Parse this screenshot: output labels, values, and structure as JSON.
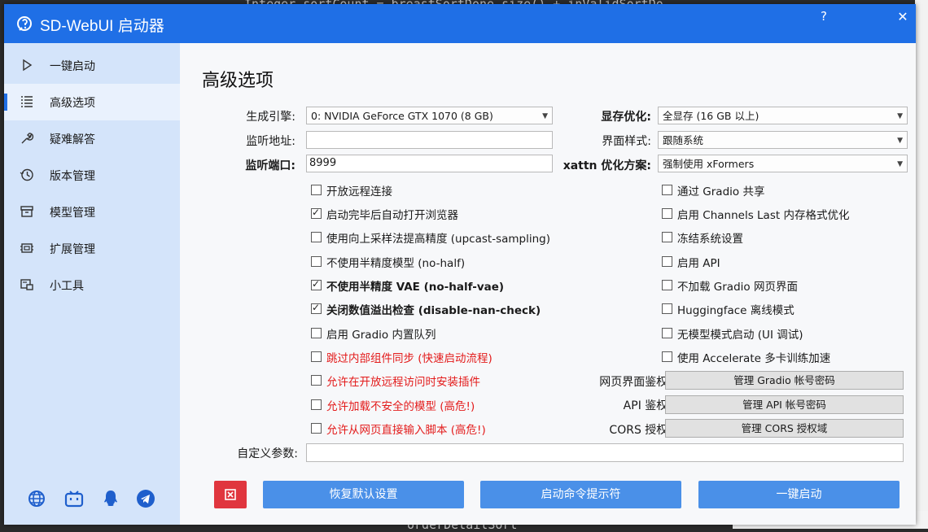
{
  "background": {
    "code_top": "Integer sortCount = breastSortDone.size() + inValidSortDo",
    "code_bottom": "orderDetailSort"
  },
  "window": {
    "title": "SD-WebUI 启动器",
    "help_glyph": "?",
    "close_glyph": "✕"
  },
  "sidebar": {
    "items": [
      {
        "label": "一键启动",
        "icon": "play-icon"
      },
      {
        "label": "高级选项",
        "icon": "list-icon",
        "active": true
      },
      {
        "label": "疑难解答",
        "icon": "wrench-icon"
      },
      {
        "label": "版本管理",
        "icon": "history-icon"
      },
      {
        "label": "模型管理",
        "icon": "archive-icon"
      },
      {
        "label": "扩展管理",
        "icon": "chip-icon"
      },
      {
        "label": "小工具",
        "icon": "tools-icon"
      }
    ],
    "footer_icons": [
      "globe-icon",
      "bilibili-icon",
      "qq-icon",
      "telegram-icon"
    ]
  },
  "page": {
    "title": "高级选项",
    "left": {
      "engine_label": "生成引擎:",
      "engine_value": "0: NVIDIA GeForce GTX 1070 (8 GB)",
      "listen_addr_label": "监听地址:",
      "listen_addr_value": "",
      "listen_port_label": "监听端口:",
      "listen_port_value": "8999",
      "checkboxes": [
        {
          "label": "开放远程连接",
          "checked": false
        },
        {
          "label": "启动完毕后自动打开浏览器",
          "checked": true
        },
        {
          "label": "使用向上采样法提高精度 (upcast-sampling)",
          "checked": false
        },
        {
          "label": "不使用半精度模型 (no-half)",
          "checked": false
        },
        {
          "label": "不使用半精度 VAE (no-half-vae)",
          "checked": true,
          "bold": true
        },
        {
          "label": "关闭数值溢出检查 (disable-nan-check)",
          "checked": true,
          "bold": true
        },
        {
          "label": "启用 Gradio 内置队列",
          "checked": false
        },
        {
          "label": "跳过内部组件同步 (快速启动流程)",
          "checked": false,
          "red": true
        },
        {
          "label": "允许在开放远程访问时安装插件",
          "checked": false,
          "red": true
        },
        {
          "label": "允许加载不安全的模型 (高危!)",
          "checked": false,
          "red": true
        },
        {
          "label": "允许从网页直接输入脚本 (高危!)",
          "checked": false,
          "red": true
        }
      ]
    },
    "right": {
      "vram_label": "显存优化:",
      "vram_value": "全显存 (16 GB 以上)",
      "theme_label": "界面样式:",
      "theme_value": "跟随系统",
      "xattn_label": "xattn 优化方案:",
      "xattn_value": "强制使用 xFormers",
      "checkboxes": [
        {
          "label": "通过 Gradio 共享",
          "checked": false
        },
        {
          "label": "启用 Channels Last 内存格式优化",
          "checked": false
        },
        {
          "label": "冻结系统设置",
          "checked": false
        },
        {
          "label": "启用 API",
          "checked": false
        },
        {
          "label": "不加载 Gradio 网页界面",
          "checked": false
        },
        {
          "label": "Huggingface 离线模式",
          "checked": false
        },
        {
          "label": "无模型模式启动 (UI 调试)",
          "checked": false
        },
        {
          "label": "使用 Accelerate 多卡训练加速",
          "checked": false
        }
      ],
      "auth_rows": [
        {
          "label": "网页界面鉴权:",
          "button": "管理 Gradio 帐号密码"
        },
        {
          "label": "API 鉴权:",
          "button": "管理 API 帐号密码"
        },
        {
          "label": "CORS 授权:",
          "button": "管理 CORS 授权域"
        }
      ]
    },
    "custom_args_label": "自定义参数:",
    "custom_args_value": "",
    "buttons": {
      "reset": "恢复默认设置",
      "cmd": "启动命令提示符",
      "launch": "一键启动"
    },
    "colors": {
      "accent": "#1f6fe6",
      "danger": "#e31b1b",
      "primary_button": "#4a90e8",
      "reset_icon_button": "#e0363e"
    }
  }
}
